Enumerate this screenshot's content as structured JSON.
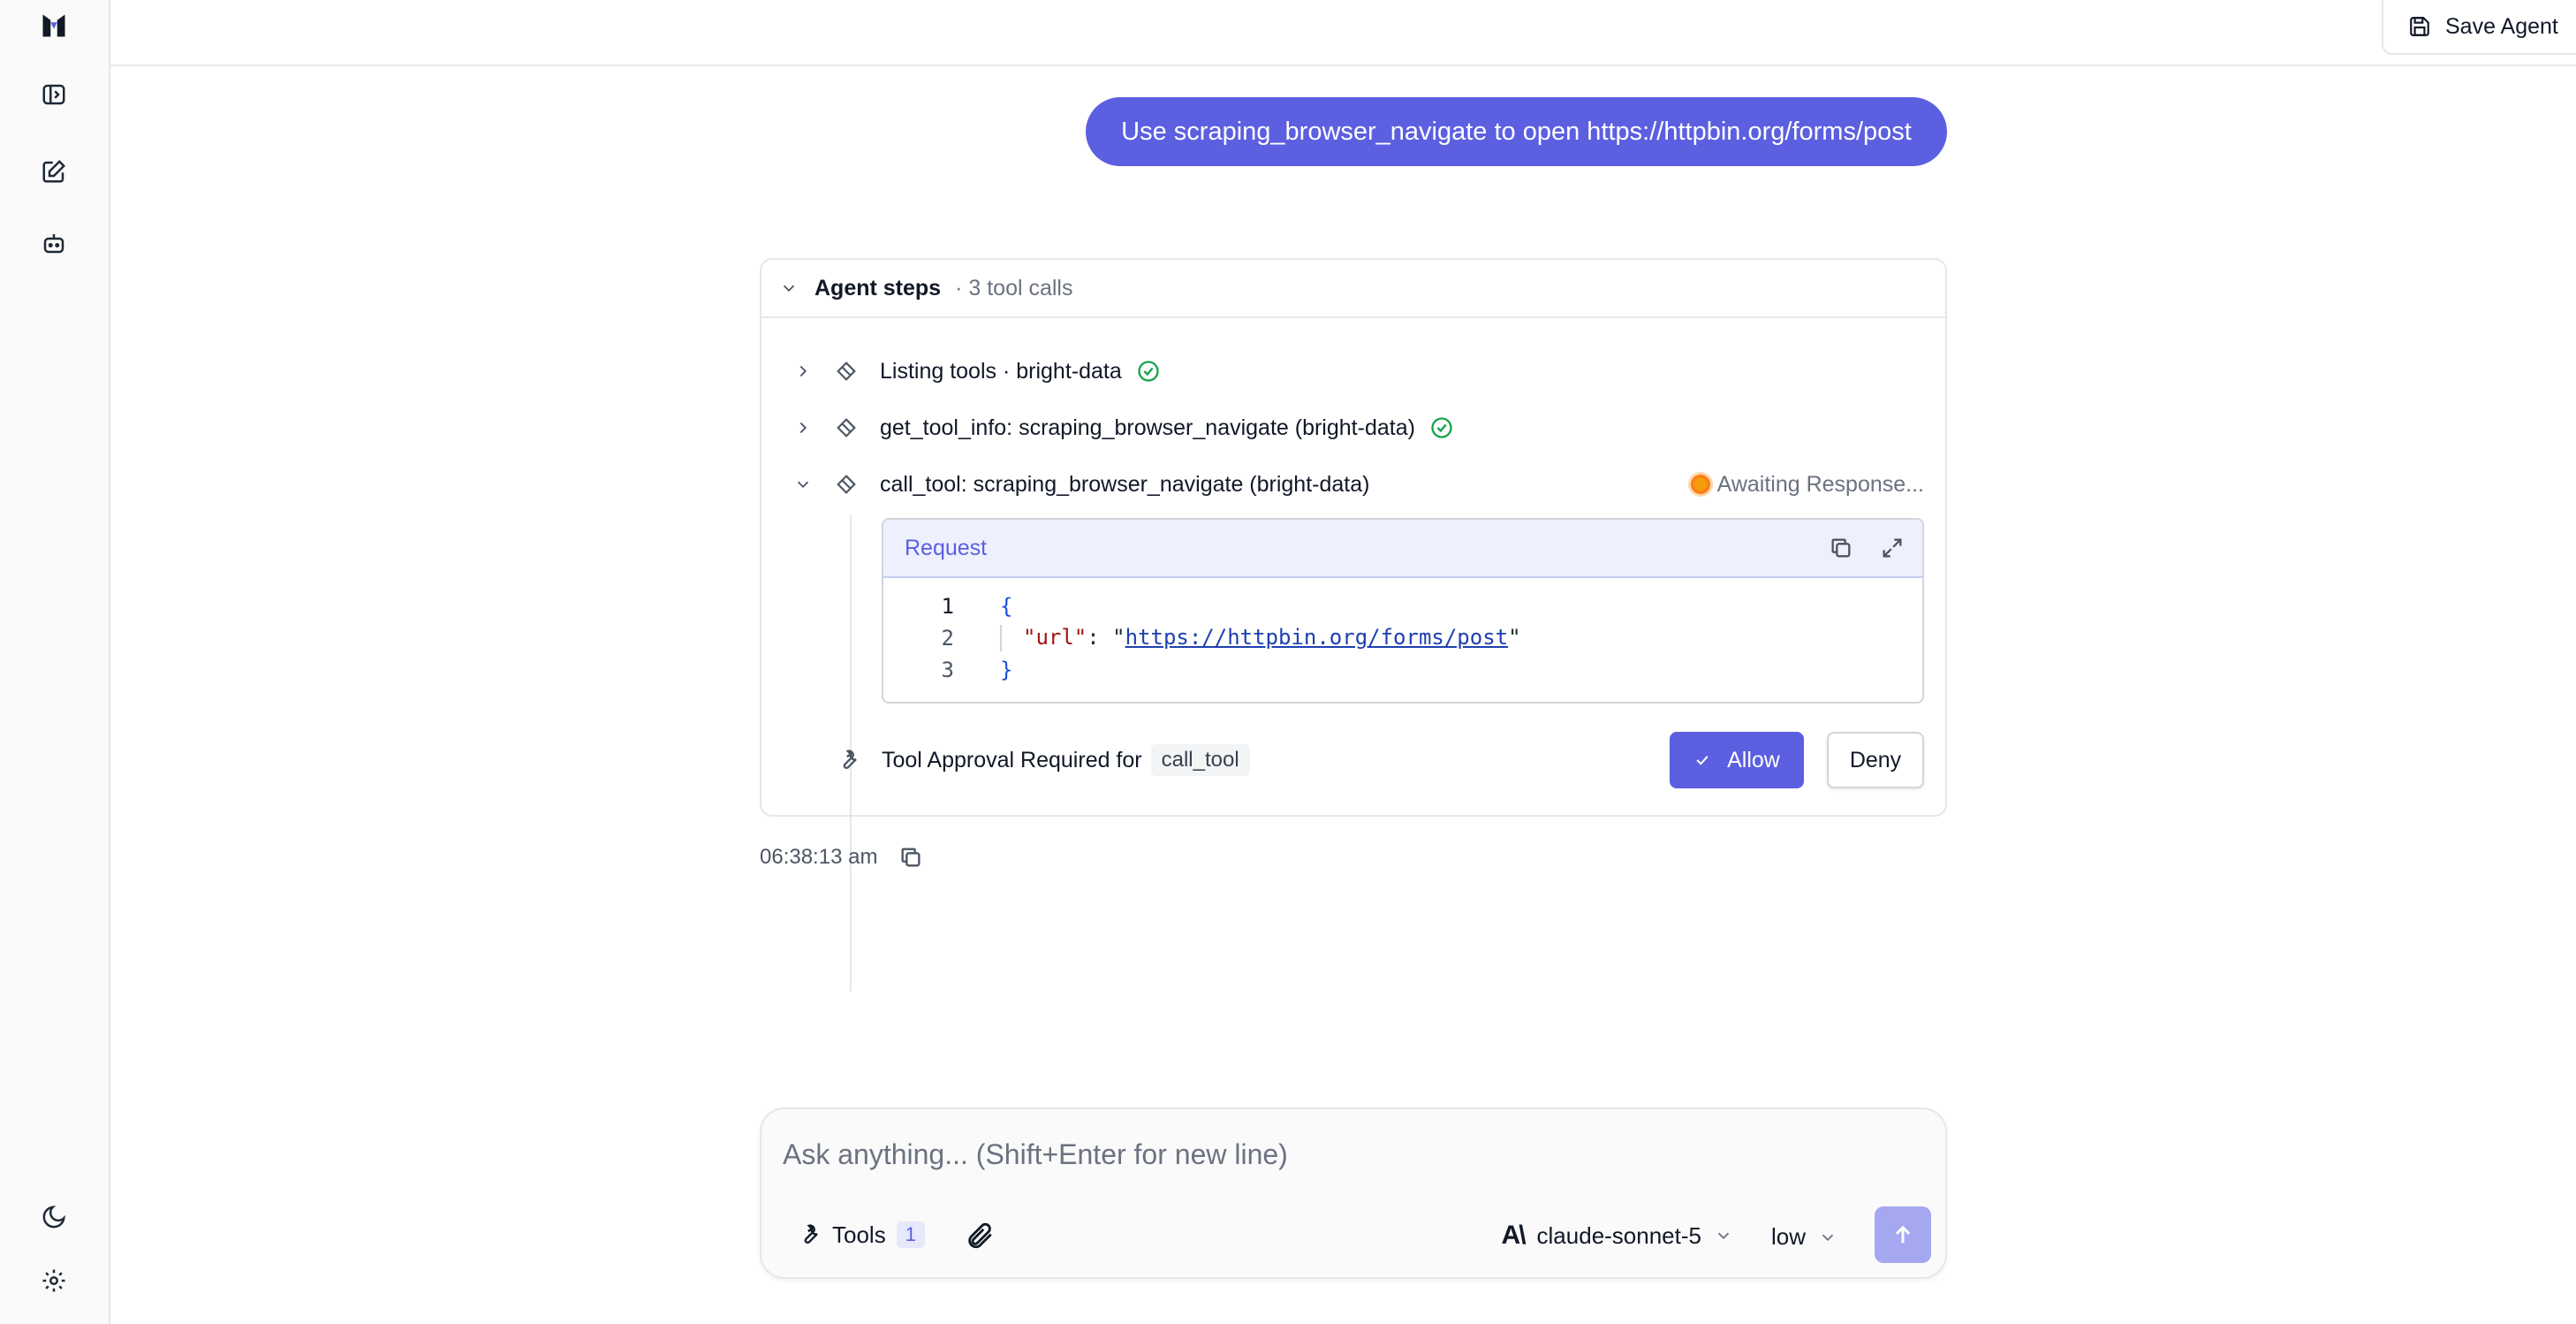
{
  "header": {
    "save_label": "Save Agent"
  },
  "sidebar": {
    "icons": [
      "app-logo",
      "toggle-sidebar-icon",
      "new-chat-icon",
      "agents-icon",
      "dark-mode-icon",
      "settings-icon"
    ]
  },
  "chat": {
    "user_message": "Use scraping_browser_navigate to open https://httpbin.org/forms/post",
    "agent_steps": {
      "title": "Agent steps",
      "subtitle": "· 3 tool calls",
      "steps": [
        {
          "label": "Listing tools · bright-data",
          "status": "done"
        },
        {
          "label": "get_tool_info: scraping_browser_navigate (bright-data)",
          "status": "done"
        },
        {
          "label": "call_tool: scraping_browser_navigate (bright-data)",
          "status": "Awaiting Response..."
        }
      ],
      "request": {
        "title": "Request",
        "line_numbers": [
          "1",
          "2",
          "3"
        ],
        "open_brace": "{",
        "key": "\"url\"",
        "colon": ": ",
        "quote_open": "\"",
        "url": "https://httpbin.org/forms/post",
        "quote_close": "\"",
        "close_brace": "}"
      },
      "approval": {
        "label": "Tool Approval Required for",
        "tool": "call_tool",
        "allow_label": "Allow",
        "deny_label": "Deny"
      }
    },
    "timestamp": "06:38:13 am"
  },
  "composer": {
    "placeholder": "Ask anything... (Shift+Enter for new line)",
    "tools_label": "Tools",
    "tools_count": "1",
    "model_logo": "A\\",
    "model": "claude-sonnet-5",
    "effort": "low"
  },
  "colors": {
    "accent": "#5b5fe0",
    "success": "#16a34a",
    "pending": "#f59e0b"
  }
}
